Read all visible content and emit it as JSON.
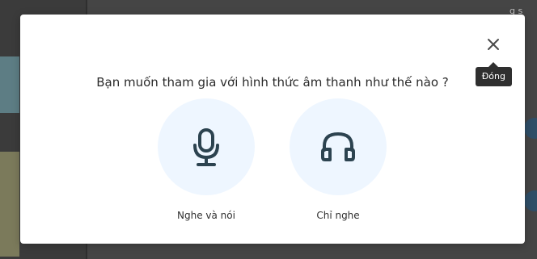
{
  "dialog": {
    "question": "Bạn muốn tham gia với hình thức âm thanh như thế nào ?",
    "close_tooltip": "Đóng",
    "options": [
      {
        "label": "Nghe và nói",
        "icon": "microphone-icon"
      },
      {
        "label": "Chỉ nghe",
        "icon": "headphones-icon"
      }
    ]
  },
  "background": {
    "top_right_text": "g\ns"
  },
  "colors": {
    "icon_stroke": "#2c4350",
    "icon_bg": "#eef6ff",
    "overlay_bg": "#454545",
    "tooltip_bg": "#2f2f2f"
  }
}
